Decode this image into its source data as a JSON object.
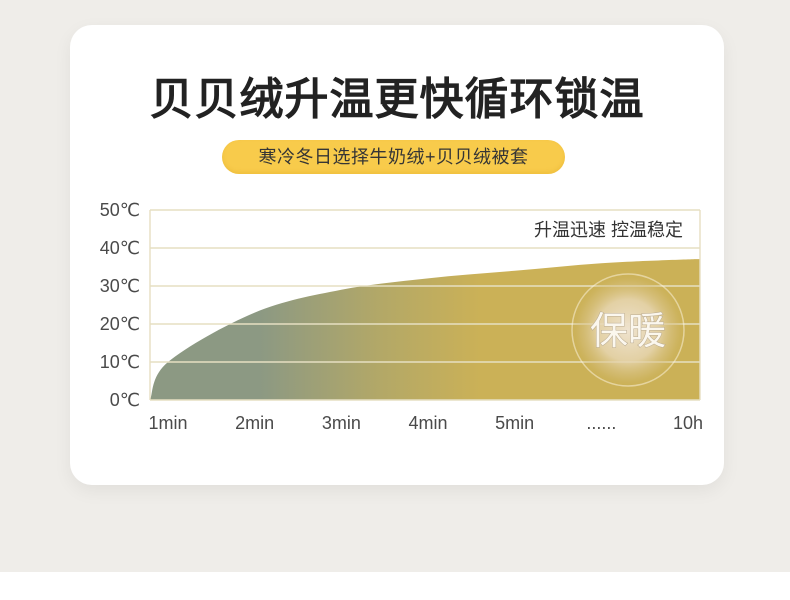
{
  "header": {
    "title": "贝贝绒升温更快循环锁温",
    "badge": "寒冷冬日选择牛奶绒+贝贝绒被套"
  },
  "colors": {
    "page_background": "#efede9",
    "card_background": "#ffffff",
    "badge_background": "#f8cb4b",
    "title_text": "#222222",
    "area_start": "#8c9983",
    "area_mid": "#b3a867",
    "area_end": "#cbb157",
    "grid_line": "#e6dfc2",
    "glow_center": "#efe3cf"
  },
  "chart_data": {
    "type": "area",
    "categories": [
      "1min",
      "2min",
      "3min",
      "4min",
      "5min",
      "......",
      "10h"
    ],
    "values": [
      10,
      23,
      29,
      32,
      34,
      36,
      37
    ],
    "ylim": [
      0,
      50
    ],
    "yticks": [
      "0℃",
      "10℃",
      "20℃",
      "30℃",
      "40℃",
      "50℃"
    ],
    "grid": true,
    "annotations": [
      "升温迅速 控温稳定",
      "保暖"
    ]
  }
}
